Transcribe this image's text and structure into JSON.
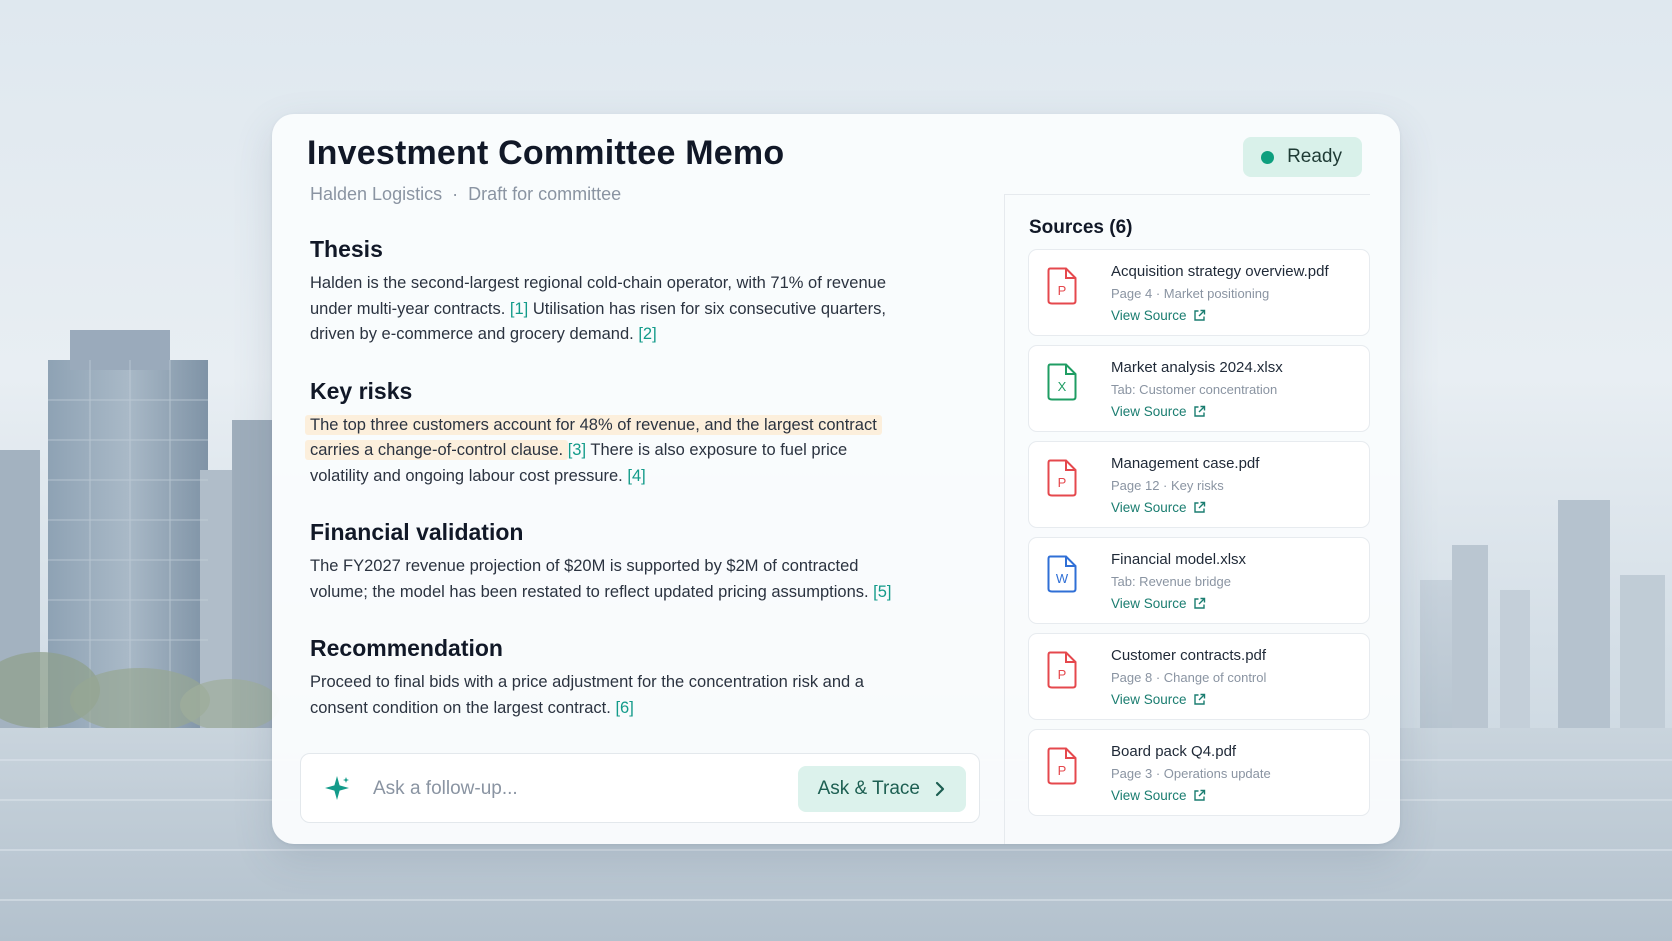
{
  "header": {
    "title": "Investment Committee Memo",
    "company": "Halden Logistics",
    "separator": "·",
    "draft_status": "Draft for committee",
    "status_label": "Ready"
  },
  "memo": {
    "thesis": {
      "heading": "Thesis",
      "text_1": "Halden is the second-largest regional cold-chain operator, with 71% of revenue under multi-year contracts.",
      "cite_1": "[1]",
      "text_2": "Utilisation has risen for six consecutive quarters, driven by e-commerce and grocery demand.",
      "cite_2": "[2]"
    },
    "key_risks": {
      "heading": "Key risks",
      "highlighted_text": "The top three customers account for 48% of revenue, and the largest contract carries a change-of-control clause.",
      "cite_3": "[3]",
      "text_2": "There is also exposure to fuel price volatility and ongoing labour cost pressure.",
      "cite_4": "[4]"
    },
    "financial_validation": {
      "heading": "Financial validation",
      "text_1": "The FY2027 revenue projection of $20M is supported by $2M of contracted volume; the model has been restated to reflect updated pricing assumptions.",
      "cite_5": "[5]"
    },
    "recommendation": {
      "heading": "Recommendation",
      "text_1": "Proceed to final bids with a price adjustment for the concentration risk and a consent condition on the largest contract.",
      "cite_6": "[6]"
    }
  },
  "ask": {
    "placeholder": "Ask a follow-up...",
    "button_label": "Ask & Trace"
  },
  "sources": {
    "heading": "Sources (6)",
    "link_label": "View Source",
    "items": [
      {
        "name": "Acquisition strategy overview.pdf",
        "meta": "Page 4 · Market positioning",
        "icon": "pdf-file-icon",
        "letter": "P",
        "color": "#e5484d"
      },
      {
        "name": "Market analysis 2024.xlsx",
        "meta": "Tab: Customer concentration",
        "icon": "excel-file-icon",
        "letter": "X",
        "color": "#1f9d63"
      },
      {
        "name": "Management case.pdf",
        "meta": "Page 12 · Key risks",
        "icon": "pdf-file-icon",
        "letter": "P",
        "color": "#e5484d"
      },
      {
        "name": "Financial model.xlsx",
        "meta": "Tab: Revenue bridge",
        "icon": "word-file-icon",
        "letter": "W",
        "color": "#2f6fd6"
      },
      {
        "name": "Customer contracts.pdf",
        "meta": "Page 8 · Change of control",
        "icon": "pdf-file-icon",
        "letter": "P",
        "color": "#e5484d"
      },
      {
        "name": "Board pack Q4.pdf",
        "meta": "Page 3 · Operations update",
        "icon": "pdf-file-icon",
        "letter": "P",
        "color": "#e5484d"
      }
    ]
  },
  "colors": {
    "accent": "#139b8a",
    "status_dot": "#0e9f7e",
    "highlight": "#fcefdc"
  }
}
